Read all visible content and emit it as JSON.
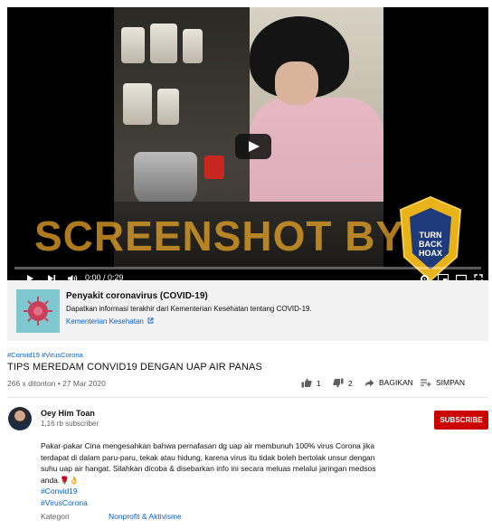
{
  "video": {
    "watermark": "SCREENSHOT BY",
    "logo_text_top": "MASYARAKAT ANTI FITNAH INDONESIA",
    "logo_text_center": "TURN BACK HOAX",
    "logo_text_bottom": "MAFINDO",
    "time": "0:00 / 0:29"
  },
  "info_panel": {
    "title": "Penyakit coronavirus (COVID-19)",
    "description": "Dapatkan informasi terakhir dari Kementerian Kesehatan tentang COVID-19.",
    "link": "Kementerian Kesehatan"
  },
  "video_info": {
    "hashtags": "#Convid19 #VirusCorona",
    "title": "TIPS MEREDAM CONVID19 DENGAN UAP AIR PANAS",
    "meta": "266 x ditonton • 27 Mar 2020",
    "likes": "1",
    "dislikes": "2",
    "share_label": "BAGIKAN",
    "save_label": "SIMPAN"
  },
  "channel": {
    "name": "Oey Him Toan",
    "subscribers": "1,16 rb subscriber",
    "subscribe_label": "SUBSCRIBE"
  },
  "description": {
    "lines": [
      "Pakar-pakar Cina mengesahkan bahwa pernafasan dg uap air membunuh 100% virus Corona jika",
      "terdapat di dalam paru-paru, tekak atau hidung, karena virus itu tidak boleh bertolak unsur dengan",
      "suhu uap air hangat. Silahkan dicoba & disebarkan info ini secara meluas melalui jaringan medsos",
      "anda.🌹👌"
    ],
    "tags": [
      "#Convid19",
      "#VirusCorona"
    ],
    "category_label": "Kategori",
    "category_value": "Nonprofit & Aktivisme"
  }
}
